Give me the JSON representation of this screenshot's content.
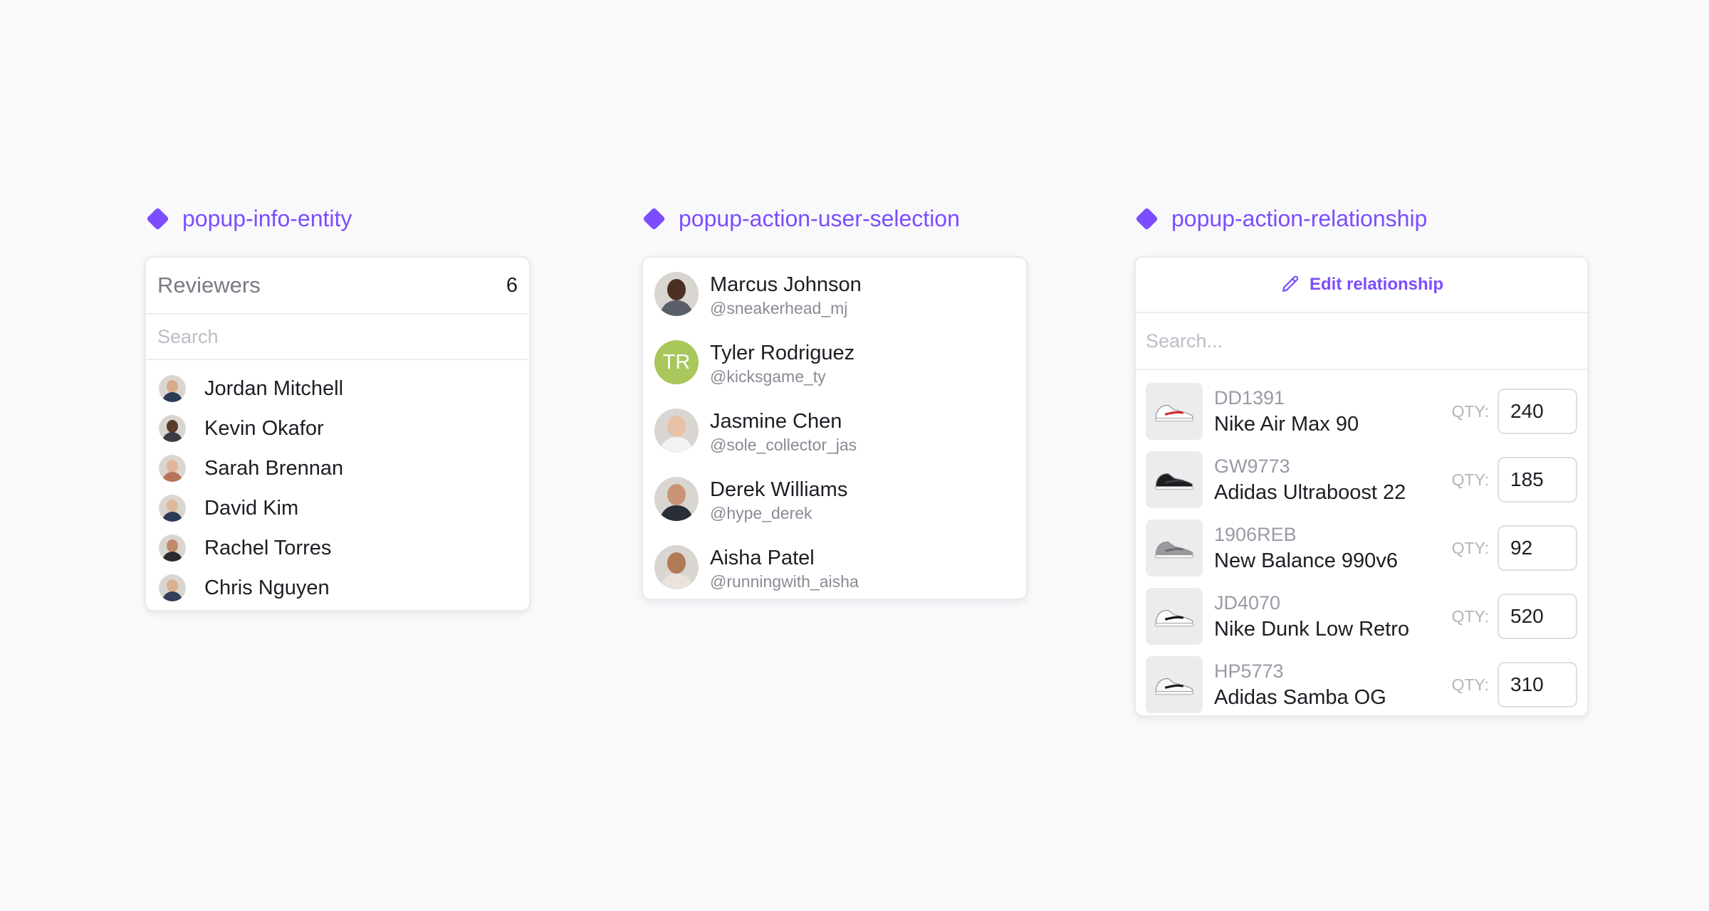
{
  "sections": {
    "info": {
      "label": "popup-info-entity"
    },
    "users": {
      "label": "popup-action-user-selection"
    },
    "relationship": {
      "label": "popup-action-relationship"
    }
  },
  "info_entity": {
    "title": "Reviewers",
    "count": "6",
    "search_placeholder": "Search",
    "reviewers": [
      {
        "name": "Jordan Mitchell",
        "skin": "#d9a98a",
        "shirt": "#2b3a55"
      },
      {
        "name": "Kevin Okafor",
        "skin": "#5a3a28",
        "shirt": "#3b3b44"
      },
      {
        "name": "Sarah Brennan",
        "skin": "#e4b49a",
        "shirt": "#b9735a"
      },
      {
        "name": "David Kim",
        "skin": "#e0b998",
        "shirt": "#2b3a55"
      },
      {
        "name": "Rachel Torres",
        "skin": "#c08a6c",
        "shirt": "#2a2a2e"
      },
      {
        "name": "Chris Nguyen",
        "skin": "#ddb08e",
        "shirt": "#34405a"
      }
    ]
  },
  "user_selection": {
    "users": [
      {
        "name": "Marcus Johnson",
        "handle": "@sneakerhead_mj",
        "skin": "#4a2f22",
        "shirt": "#5a5f6a"
      },
      {
        "name": "Tyler Rodriguez",
        "handle": "@kicksgame_ty",
        "initials": "TR"
      },
      {
        "name": "Jasmine Chen",
        "handle": "@sole_collector_jas",
        "skin": "#e8c2a6",
        "shirt": "#f2f2f2"
      },
      {
        "name": "Derek Williams",
        "handle": "@hype_derek",
        "skin": "#c99476",
        "shirt": "#2a2e36"
      },
      {
        "name": "Aisha Patel",
        "handle": "@runningwith_aisha",
        "skin": "#b07a58",
        "shirt": "#e9e3dc"
      }
    ]
  },
  "relationship": {
    "header_label": "Edit relationship",
    "search_placeholder": "Search...",
    "qty_label": "QTY:",
    "items": [
      {
        "sku": "DD1391",
        "name": "Nike Air Max 90",
        "qty": "240",
        "shoe_color": "#ffffff",
        "accent": "#d22a2a"
      },
      {
        "sku": "GW9773",
        "name": "Adidas Ultraboost 22",
        "qty": "185",
        "shoe_color": "#1c1c1f",
        "accent": "#3a3a40"
      },
      {
        "sku": "1906REB",
        "name": "New Balance 990v6",
        "qty": "92",
        "shoe_color": "#9a9a9e",
        "accent": "#6e6e74"
      },
      {
        "sku": "JD4070",
        "name": "Nike Dunk Low Retro",
        "qty": "520",
        "shoe_color": "#ffffff",
        "accent": "#141416"
      },
      {
        "sku": "HP5773",
        "name": "Adidas Samba OG",
        "qty": "310",
        "shoe_color": "#f7f7f5",
        "accent": "#1b1b1d"
      }
    ]
  }
}
